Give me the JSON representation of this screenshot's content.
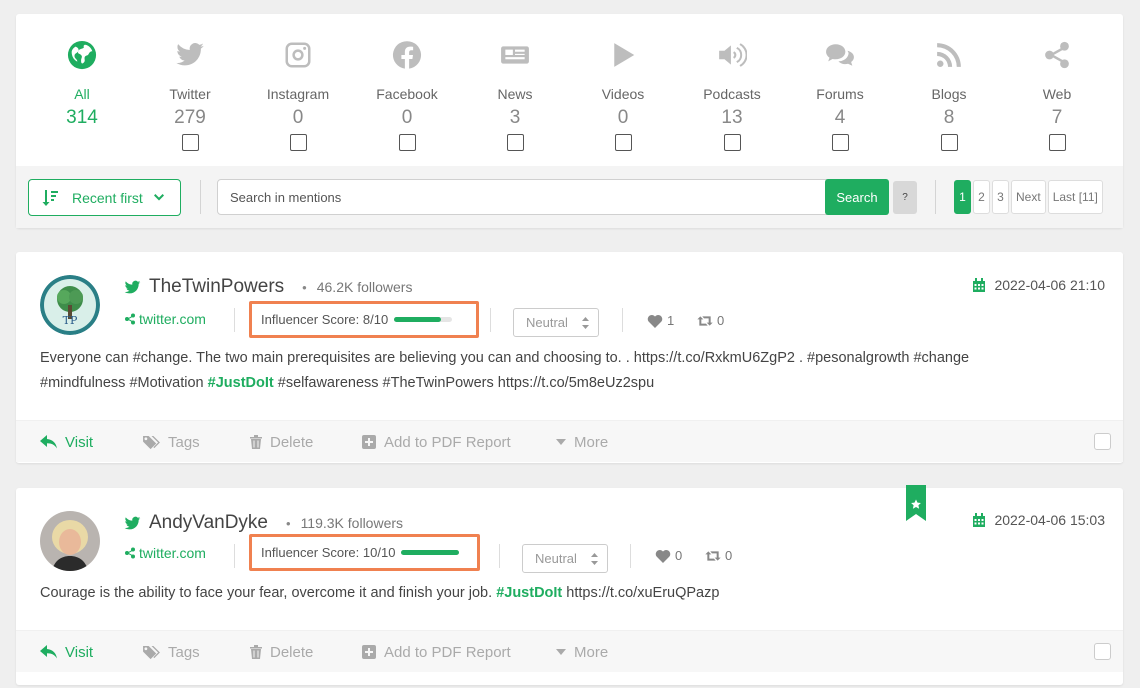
{
  "sources": [
    {
      "id": "all",
      "label": "All",
      "count": "314",
      "icon": "globe-icon",
      "active": true,
      "checkbox": false
    },
    {
      "id": "twitter",
      "label": "Twitter",
      "count": "279",
      "icon": "twitter-icon",
      "checkbox": true
    },
    {
      "id": "instagram",
      "label": "Instagram",
      "count": "0",
      "icon": "instagram-icon",
      "checkbox": true
    },
    {
      "id": "facebook",
      "label": "Facebook",
      "count": "0",
      "icon": "facebook-icon",
      "checkbox": true
    },
    {
      "id": "news",
      "label": "News",
      "count": "3",
      "icon": "newspaper-icon",
      "checkbox": true
    },
    {
      "id": "videos",
      "label": "Videos",
      "count": "0",
      "icon": "play-icon",
      "checkbox": true
    },
    {
      "id": "podcasts",
      "label": "Podcasts",
      "count": "13",
      "icon": "volume-icon",
      "checkbox": true
    },
    {
      "id": "forums",
      "label": "Forums",
      "count": "4",
      "icon": "comments-icon",
      "checkbox": true
    },
    {
      "id": "blogs",
      "label": "Blogs",
      "count": "8",
      "icon": "rss-icon",
      "checkbox": true
    },
    {
      "id": "web",
      "label": "Web",
      "count": "7",
      "icon": "share-icon",
      "checkbox": true
    }
  ],
  "toolbar": {
    "sort_label": "Recent first",
    "search_placeholder": "Search in mentions",
    "search_button": "Search",
    "help_button": "?"
  },
  "pagination": {
    "pages": [
      "1",
      "2",
      "3"
    ],
    "active": "1",
    "next": "Next",
    "last": "Last [11]"
  },
  "actions": {
    "visit": "Visit",
    "tags": "Tags",
    "delete": "Delete",
    "pdf": "Add to PDF Report",
    "more": "More"
  },
  "mentions": [
    {
      "author": "TheTwinPowers",
      "dot": "•",
      "followers": "46.2K followers",
      "source": "twitter.com",
      "influencer_score": "Influencer Score: 8/10",
      "score_fraction": 0.8,
      "sentiment": "Neutral",
      "likes": "1",
      "retweets": "0",
      "date": "2022-04-06 21:10",
      "text_before": "Everyone can #change. The two main prerequisites are believing you can and choosing to. . https://t.co/RxkmU6ZgP2 . #pesonalgrowth #change #mindfulness #Motivation ",
      "text_highlight": "#JustDoIt",
      "text_after": " #selfawareness #TheTwinPowers https://t.co/5m8eUz2spu",
      "avatar_monogram": "TP",
      "bookmarked": false
    },
    {
      "author": "AndyVanDyke",
      "dot": "•",
      "followers": "119.3K followers",
      "source": "twitter.com",
      "influencer_score": "Influencer Score: 10/10",
      "score_fraction": 1.0,
      "sentiment": "Neutral",
      "likes": "0",
      "retweets": "0",
      "date": "2022-04-06 15:03",
      "text_before": "Courage is the ability to face your fear, overcome it and finish your job. ",
      "text_highlight": "#JustDoIt",
      "text_after": " https://t.co/xuEruQPazp",
      "bookmarked": true
    }
  ],
  "colors": {
    "accent": "#1fad60",
    "highlight_box": "#f08150"
  }
}
